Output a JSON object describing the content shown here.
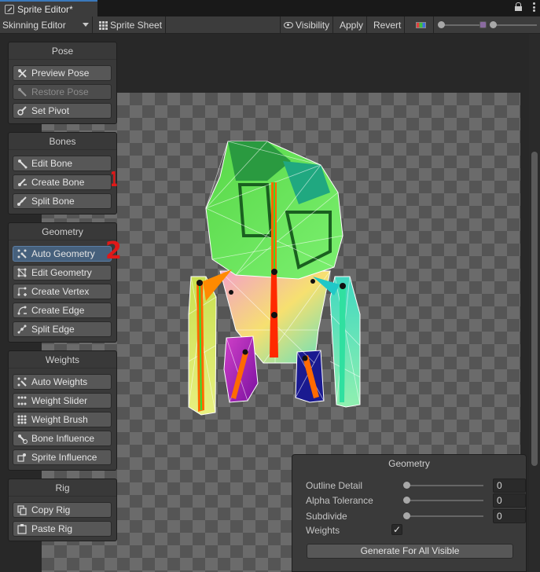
{
  "window": {
    "tab_title": "Sprite Editor*"
  },
  "toolbar": {
    "mode_dropdown": "Skinning Editor",
    "sprite_sheet": "Sprite Sheet",
    "visibility": "Visibility",
    "apply": "Apply",
    "revert": "Revert"
  },
  "panels": {
    "pose": {
      "title": "Pose",
      "buttons": [
        "Preview Pose",
        "Restore Pose",
        "Set Pivot"
      ]
    },
    "bones": {
      "title": "Bones",
      "buttons": [
        "Edit Bone",
        "Create Bone",
        "Split Bone"
      ]
    },
    "geometry": {
      "title": "Geometry",
      "buttons": [
        "Auto Geometry",
        "Edit Geometry",
        "Create Vertex",
        "Create Edge",
        "Split Edge"
      ]
    },
    "weights": {
      "title": "Weights",
      "buttons": [
        "Auto Weights",
        "Weight Slider",
        "Weight Brush",
        "Bone Influence",
        "Sprite Influence"
      ]
    },
    "rig": {
      "title": "Rig",
      "buttons": [
        "Copy Rig",
        "Paste Rig"
      ]
    }
  },
  "inspector": {
    "title": "Geometry",
    "outline_detail_label": "Outline Detail",
    "outline_detail_value": "0",
    "alpha_tolerance_label": "Alpha Tolerance",
    "alpha_tolerance_value": "0",
    "subdivide_label": "Subdivide",
    "subdivide_value": "0",
    "weights_label": "Weights",
    "weights_checked": true,
    "generate_button": "Generate For All Visible"
  },
  "annotations": {
    "mark_1": "1",
    "mark_2": "2"
  },
  "colors": {
    "accent": "#3a79bb",
    "active_button": "#46607c",
    "annotation": "#e01818"
  }
}
